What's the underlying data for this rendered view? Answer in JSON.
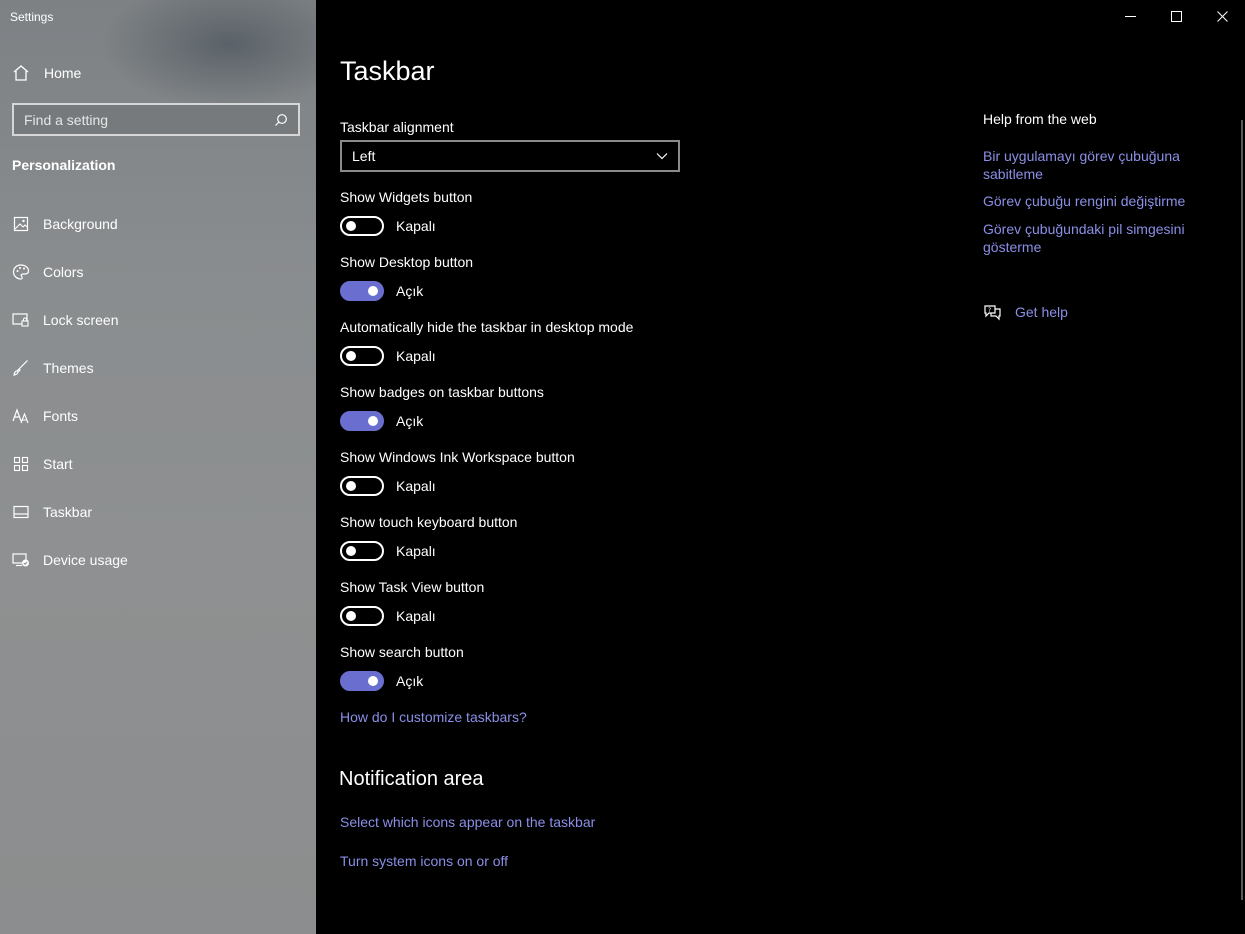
{
  "app": {
    "title": "Settings"
  },
  "sidebar": {
    "home_label": "Home",
    "search_placeholder": "Find a setting",
    "section": "Personalization",
    "items": [
      {
        "label": "Background",
        "icon": "image-icon"
      },
      {
        "label": "Colors",
        "icon": "palette-icon"
      },
      {
        "label": "Lock screen",
        "icon": "lock-screen-icon"
      },
      {
        "label": "Themes",
        "icon": "brush-icon"
      },
      {
        "label": "Fonts",
        "icon": "fonts-icon"
      },
      {
        "label": "Start",
        "icon": "start-icon"
      },
      {
        "label": "Taskbar",
        "icon": "taskbar-icon"
      },
      {
        "label": "Device usage",
        "icon": "device-usage-icon"
      }
    ]
  },
  "main": {
    "title": "Taskbar",
    "alignment": {
      "label": "Taskbar alignment",
      "value": "Left"
    },
    "settings": [
      {
        "label": "Show Widgets button",
        "state": "Kapalı",
        "on": false
      },
      {
        "label": "Show Desktop button",
        "state": "Açık",
        "on": true
      },
      {
        "label": "Automatically hide the taskbar in desktop mode",
        "state": "Kapalı",
        "on": false
      },
      {
        "label": "Show badges on taskbar buttons",
        "state": "Açık",
        "on": true
      },
      {
        "label": "Show Windows Ink Workspace button",
        "state": "Kapalı",
        "on": false
      },
      {
        "label": "Show touch keyboard button",
        "state": "Kapalı",
        "on": false
      },
      {
        "label": "Show Task View button",
        "state": "Kapalı",
        "on": false
      },
      {
        "label": "Show search button",
        "state": "Açık",
        "on": true
      }
    ],
    "customize_link": "How do I customize taskbars?",
    "notification": {
      "heading": "Notification area",
      "link1": "Select which icons appear on the taskbar",
      "link2": "Turn system icons on or off"
    }
  },
  "help": {
    "title": "Help from the web",
    "links": [
      "Bir uygulamayı görev çubuğuna sabitleme",
      "Görev çubuğu rengini değiştirme",
      "Görev çubuğundaki pil simgesini gösterme"
    ],
    "get_help": "Get help"
  },
  "colors": {
    "accent": "#6a6fcf",
    "link": "#8b8fe6"
  }
}
